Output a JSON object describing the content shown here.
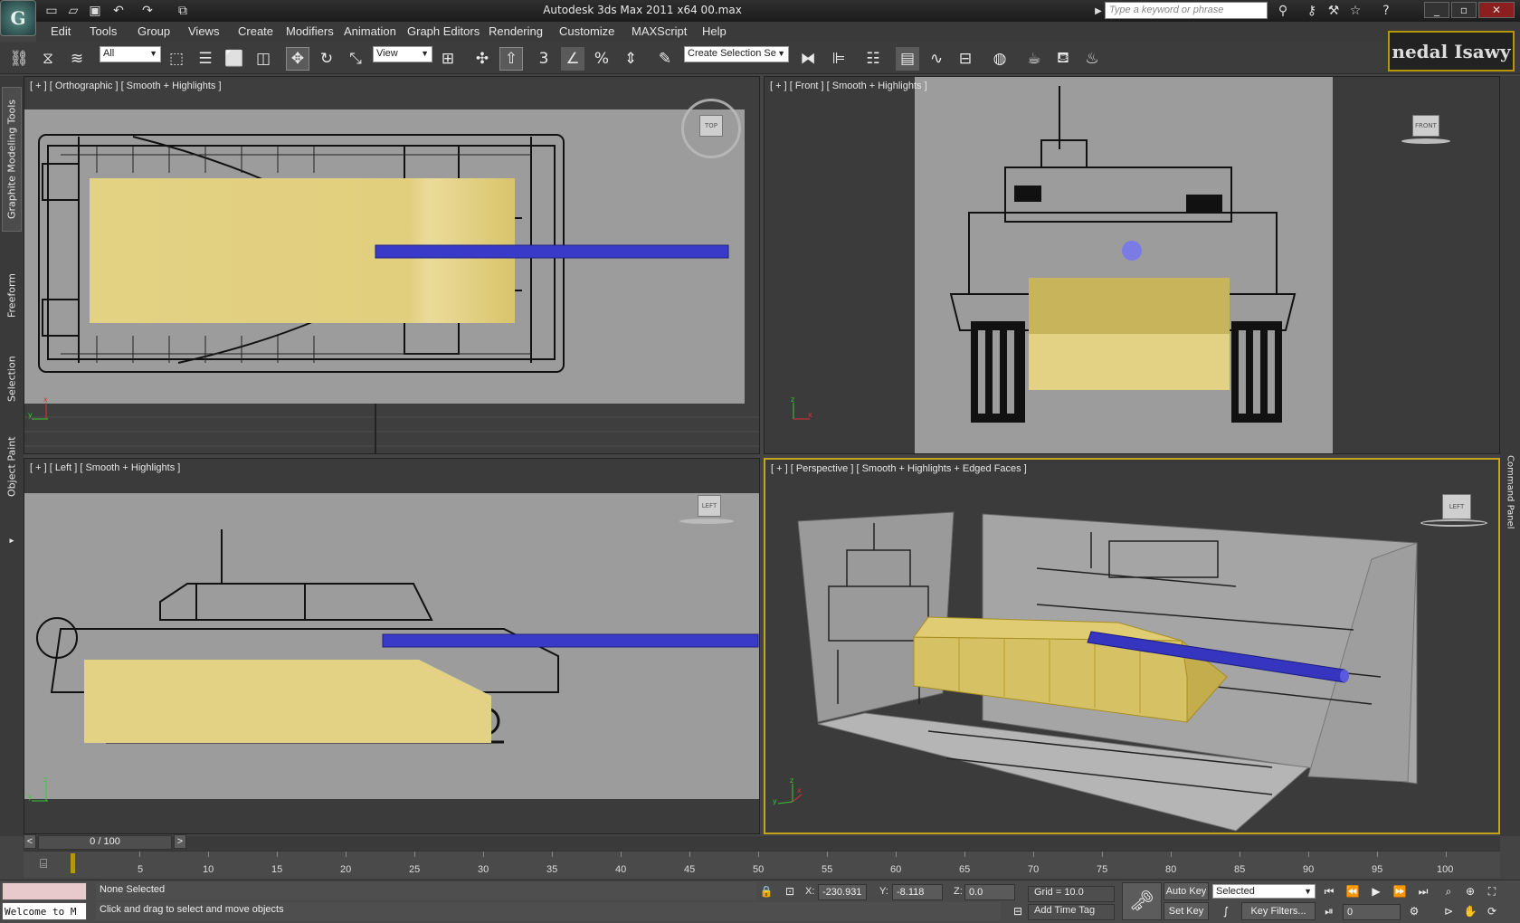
{
  "window": {
    "title": "Autodesk 3ds Max  2011 x64      00.max",
    "logo_letter": "G"
  },
  "search": {
    "placeholder": "Type a keyword or phrase"
  },
  "menu": [
    "Edit",
    "Tools",
    "Group",
    "Views",
    "Create",
    "Modifiers",
    "Animation",
    "Graph Editors",
    "Rendering",
    "Customize",
    "MAXScript",
    "Help"
  ],
  "toolbar": {
    "filter_value": "All",
    "ref_coord_value": "View",
    "named_selection_value": "Create Selection Se",
    "snap_label": "3",
    "angle_snap_label": "%",
    "signature": "nedal Isawy"
  },
  "left_tabs": [
    "Graphite Modeling Tools",
    "Freeform",
    "Selection",
    "Object Paint"
  ],
  "right_tab": "Command Panel",
  "viewports": {
    "top": {
      "label": "[ + ] [ Orthographic ] [ Smooth + Highlights ]",
      "cube": "TOP"
    },
    "front": {
      "label": "[ + ] [ Front ] [ Smooth + Highlights ]",
      "cube": "FRONT"
    },
    "left": {
      "label": "[ + ] [ Left ] [ Smooth + Highlights ]",
      "cube": "LEFT"
    },
    "persp": {
      "label": "[ + ] [ Perspective ] [ Smooth + Highlights + Edged Faces ]",
      "cube": "LEFT"
    }
  },
  "timeline": {
    "frame_display": "0 / 100",
    "ticks": [
      "5",
      "10",
      "15",
      "20",
      "25",
      "30",
      "35",
      "40",
      "45",
      "50",
      "55",
      "60",
      "65",
      "70",
      "75",
      "80",
      "85",
      "90",
      "95",
      "100"
    ]
  },
  "status": {
    "maxscript": "Welcome to M",
    "selection": "None Selected",
    "prompt": "Click and drag to select and move objects",
    "x_label": "X:",
    "x_value": "-230.931",
    "y_label": "Y:",
    "y_value": "-8.118",
    "z_label": "Z:",
    "z_value": "0.0",
    "grid": "Grid = 10.0",
    "add_time_tag": "Add Time Tag",
    "auto_key": "Auto Key",
    "set_key": "Set Key",
    "key_mode_value": "Selected",
    "key_filters": "Key Filters...",
    "current_frame": "0"
  },
  "colors": {
    "accent": "#c7a31a",
    "hull": "#e3d283",
    "barrel": "#3a3ac8",
    "viewport_bg": "#3b3b3b",
    "plane": "#9c9c9c"
  }
}
